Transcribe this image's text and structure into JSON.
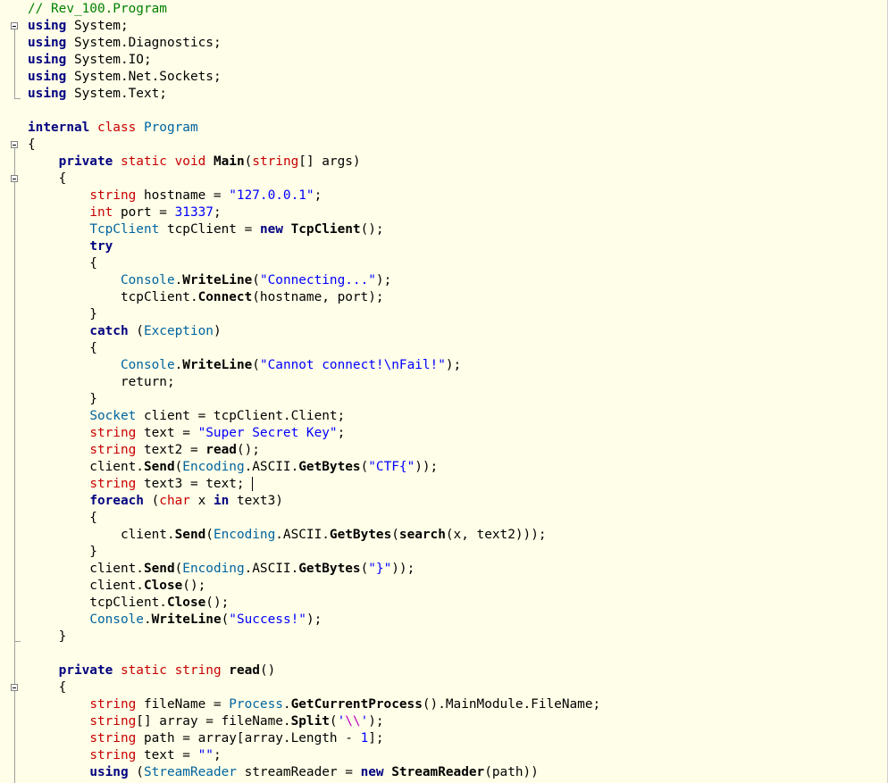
{
  "editor": {
    "lines": [
      [
        {
          "t": "// Rev_100.Program",
          "c": "comment"
        }
      ],
      [
        {
          "t": "using",
          "c": "kw"
        },
        {
          "t": " System;",
          "c": "plain"
        }
      ],
      [
        {
          "t": "using",
          "c": "kw"
        },
        {
          "t": " System.Diagnostics;",
          "c": "plain"
        }
      ],
      [
        {
          "t": "using",
          "c": "kw"
        },
        {
          "t": " System.IO;",
          "c": "plain"
        }
      ],
      [
        {
          "t": "using",
          "c": "kw"
        },
        {
          "t": " System.Net.Sockets;",
          "c": "plain"
        }
      ],
      [
        {
          "t": "using",
          "c": "kw"
        },
        {
          "t": " System.Text;",
          "c": "plain"
        }
      ],
      [],
      [
        {
          "t": "internal",
          "c": "kw"
        },
        {
          "t": " ",
          "c": "plain"
        },
        {
          "t": "class",
          "c": "type"
        },
        {
          "t": " ",
          "c": "plain"
        },
        {
          "t": "Program",
          "c": "cls"
        }
      ],
      [
        {
          "t": "{",
          "c": "plain"
        }
      ],
      [
        {
          "t": "    ",
          "c": "plain"
        },
        {
          "t": "private",
          "c": "kw"
        },
        {
          "t": " ",
          "c": "plain"
        },
        {
          "t": "static",
          "c": "type"
        },
        {
          "t": " ",
          "c": "plain"
        },
        {
          "t": "void",
          "c": "type"
        },
        {
          "t": " ",
          "c": "plain"
        },
        {
          "t": "Main",
          "c": "meth"
        },
        {
          "t": "(",
          "c": "plain"
        },
        {
          "t": "string",
          "c": "type"
        },
        {
          "t": "[] args)",
          "c": "plain"
        }
      ],
      [
        {
          "t": "    {",
          "c": "plain"
        }
      ],
      [
        {
          "t": "        ",
          "c": "plain"
        },
        {
          "t": "string",
          "c": "type"
        },
        {
          "t": " hostname = ",
          "c": "plain"
        },
        {
          "t": "\"127.0.0.1\"",
          "c": "str"
        },
        {
          "t": ";",
          "c": "plain"
        }
      ],
      [
        {
          "t": "        ",
          "c": "plain"
        },
        {
          "t": "int",
          "c": "type"
        },
        {
          "t": " port = ",
          "c": "plain"
        },
        {
          "t": "31337",
          "c": "num"
        },
        {
          "t": ";",
          "c": "plain"
        }
      ],
      [
        {
          "t": "        ",
          "c": "plain"
        },
        {
          "t": "TcpClient",
          "c": "cls"
        },
        {
          "t": " tcpClient = ",
          "c": "plain"
        },
        {
          "t": "new",
          "c": "kw"
        },
        {
          "t": " ",
          "c": "plain"
        },
        {
          "t": "TcpClient",
          "c": "meth"
        },
        {
          "t": "();",
          "c": "plain"
        }
      ],
      [
        {
          "t": "        ",
          "c": "plain"
        },
        {
          "t": "try",
          "c": "kw"
        }
      ],
      [
        {
          "t": "        {",
          "c": "plain"
        }
      ],
      [
        {
          "t": "            ",
          "c": "plain"
        },
        {
          "t": "Console",
          "c": "cls"
        },
        {
          "t": ".",
          "c": "plain"
        },
        {
          "t": "WriteLine",
          "c": "meth"
        },
        {
          "t": "(",
          "c": "plain"
        },
        {
          "t": "\"Connecting...\"",
          "c": "str"
        },
        {
          "t": ");",
          "c": "plain"
        }
      ],
      [
        {
          "t": "            tcpClient.",
          "c": "plain"
        },
        {
          "t": "Connect",
          "c": "meth"
        },
        {
          "t": "(hostname, port);",
          "c": "plain"
        }
      ],
      [
        {
          "t": "        }",
          "c": "plain"
        }
      ],
      [
        {
          "t": "        ",
          "c": "plain"
        },
        {
          "t": "catch",
          "c": "kw"
        },
        {
          "t": " (",
          "c": "plain"
        },
        {
          "t": "Exception",
          "c": "cls"
        },
        {
          "t": ")",
          "c": "plain"
        }
      ],
      [
        {
          "t": "        {",
          "c": "plain"
        }
      ],
      [
        {
          "t": "            ",
          "c": "plain"
        },
        {
          "t": "Console",
          "c": "cls"
        },
        {
          "t": ".",
          "c": "plain"
        },
        {
          "t": "WriteLine",
          "c": "meth"
        },
        {
          "t": "(",
          "c": "plain"
        },
        {
          "t": "\"Cannot connect!\\nFail!\"",
          "c": "str"
        },
        {
          "t": ");",
          "c": "plain"
        }
      ],
      [
        {
          "t": "            return;",
          "c": "plain"
        }
      ],
      [
        {
          "t": "        }",
          "c": "plain"
        }
      ],
      [
        {
          "t": "        ",
          "c": "plain"
        },
        {
          "t": "Socket",
          "c": "cls"
        },
        {
          "t": " client = tcpClient.Client;",
          "c": "plain"
        }
      ],
      [
        {
          "t": "        ",
          "c": "plain"
        },
        {
          "t": "string",
          "c": "type"
        },
        {
          "t": " text = ",
          "c": "plain"
        },
        {
          "t": "\"Super Secret Key\"",
          "c": "str"
        },
        {
          "t": ";",
          "c": "plain"
        }
      ],
      [
        {
          "t": "        ",
          "c": "plain"
        },
        {
          "t": "string",
          "c": "type"
        },
        {
          "t": " text2 = ",
          "c": "plain"
        },
        {
          "t": "read",
          "c": "meth"
        },
        {
          "t": "();",
          "c": "plain"
        }
      ],
      [
        {
          "t": "        client.",
          "c": "plain"
        },
        {
          "t": "Send",
          "c": "meth"
        },
        {
          "t": "(",
          "c": "plain"
        },
        {
          "t": "Encoding",
          "c": "cls"
        },
        {
          "t": ".ASCII.",
          "c": "plain"
        },
        {
          "t": "GetBytes",
          "c": "meth"
        },
        {
          "t": "(",
          "c": "plain"
        },
        {
          "t": "\"CTF{\"",
          "c": "str"
        },
        {
          "t": "));",
          "c": "plain"
        }
      ],
      [
        {
          "t": "        ",
          "c": "plain"
        },
        {
          "t": "string",
          "c": "type"
        },
        {
          "t": " text3 = text;",
          "c": "plain"
        }
      ],
      [
        {
          "t": "        ",
          "c": "plain"
        },
        {
          "t": "foreach",
          "c": "kw"
        },
        {
          "t": " (",
          "c": "plain"
        },
        {
          "t": "char",
          "c": "type"
        },
        {
          "t": " x ",
          "c": "plain"
        },
        {
          "t": "in",
          "c": "kw"
        },
        {
          "t": " text3)",
          "c": "plain"
        }
      ],
      [
        {
          "t": "        {",
          "c": "plain"
        }
      ],
      [
        {
          "t": "            client.",
          "c": "plain"
        },
        {
          "t": "Send",
          "c": "meth"
        },
        {
          "t": "(",
          "c": "plain"
        },
        {
          "t": "Encoding",
          "c": "cls"
        },
        {
          "t": ".ASCII.",
          "c": "plain"
        },
        {
          "t": "GetBytes",
          "c": "meth"
        },
        {
          "t": "(",
          "c": "plain"
        },
        {
          "t": "search",
          "c": "meth"
        },
        {
          "t": "(x, text2)));",
          "c": "plain"
        }
      ],
      [
        {
          "t": "        }",
          "c": "plain"
        }
      ],
      [
        {
          "t": "        client.",
          "c": "plain"
        },
        {
          "t": "Send",
          "c": "meth"
        },
        {
          "t": "(",
          "c": "plain"
        },
        {
          "t": "Encoding",
          "c": "cls"
        },
        {
          "t": ".ASCII.",
          "c": "plain"
        },
        {
          "t": "GetBytes",
          "c": "meth"
        },
        {
          "t": "(",
          "c": "plain"
        },
        {
          "t": "\"}\"",
          "c": "str"
        },
        {
          "t": "));",
          "c": "plain"
        }
      ],
      [
        {
          "t": "        client.",
          "c": "plain"
        },
        {
          "t": "Close",
          "c": "meth"
        },
        {
          "t": "();",
          "c": "plain"
        }
      ],
      [
        {
          "t": "        tcpClient.",
          "c": "plain"
        },
        {
          "t": "Close",
          "c": "meth"
        },
        {
          "t": "();",
          "c": "plain"
        }
      ],
      [
        {
          "t": "        ",
          "c": "plain"
        },
        {
          "t": "Console",
          "c": "cls"
        },
        {
          "t": ".",
          "c": "plain"
        },
        {
          "t": "WriteLine",
          "c": "meth"
        },
        {
          "t": "(",
          "c": "plain"
        },
        {
          "t": "\"Success!\"",
          "c": "str"
        },
        {
          "t": ");",
          "c": "plain"
        }
      ],
      [
        {
          "t": "    }",
          "c": "plain"
        }
      ],
      [],
      [
        {
          "t": "    ",
          "c": "plain"
        },
        {
          "t": "private",
          "c": "kw"
        },
        {
          "t": " ",
          "c": "plain"
        },
        {
          "t": "static",
          "c": "type"
        },
        {
          "t": " ",
          "c": "plain"
        },
        {
          "t": "string",
          "c": "type"
        },
        {
          "t": " ",
          "c": "plain"
        },
        {
          "t": "read",
          "c": "meth"
        },
        {
          "t": "()",
          "c": "plain"
        }
      ],
      [
        {
          "t": "    {",
          "c": "plain"
        }
      ],
      [
        {
          "t": "        ",
          "c": "plain"
        },
        {
          "t": "string",
          "c": "type"
        },
        {
          "t": " fileName = ",
          "c": "plain"
        },
        {
          "t": "Process",
          "c": "cls"
        },
        {
          "t": ".",
          "c": "plain"
        },
        {
          "t": "GetCurrentProcess",
          "c": "meth"
        },
        {
          "t": "().MainModule.FileName;",
          "c": "plain"
        }
      ],
      [
        {
          "t": "        ",
          "c": "plain"
        },
        {
          "t": "string",
          "c": "type"
        },
        {
          "t": "[] array = fileName.",
          "c": "plain"
        },
        {
          "t": "Split",
          "c": "meth"
        },
        {
          "t": "(",
          "c": "plain"
        },
        {
          "t": "'",
          "c": "str"
        },
        {
          "t": "\\\\",
          "c": "esc"
        },
        {
          "t": "'",
          "c": "str"
        },
        {
          "t": ");",
          "c": "plain"
        }
      ],
      [
        {
          "t": "        ",
          "c": "plain"
        },
        {
          "t": "string",
          "c": "type"
        },
        {
          "t": " path = array[array.Length - ",
          "c": "plain"
        },
        {
          "t": "1",
          "c": "num"
        },
        {
          "t": "];",
          "c": "plain"
        }
      ],
      [
        {
          "t": "        ",
          "c": "plain"
        },
        {
          "t": "string",
          "c": "type"
        },
        {
          "t": " text = ",
          "c": "plain"
        },
        {
          "t": "\"\"",
          "c": "str"
        },
        {
          "t": ";",
          "c": "plain"
        }
      ],
      [
        {
          "t": "        ",
          "c": "plain"
        },
        {
          "t": "using",
          "c": "kw"
        },
        {
          "t": " (",
          "c": "plain"
        },
        {
          "t": "StreamReader",
          "c": "cls"
        },
        {
          "t": " streamReader = ",
          "c": "plain"
        },
        {
          "t": "new",
          "c": "kw"
        },
        {
          "t": " ",
          "c": "plain"
        },
        {
          "t": "StreamReader",
          "c": "meth"
        },
        {
          "t": "(path))",
          "c": "plain"
        }
      ]
    ]
  }
}
